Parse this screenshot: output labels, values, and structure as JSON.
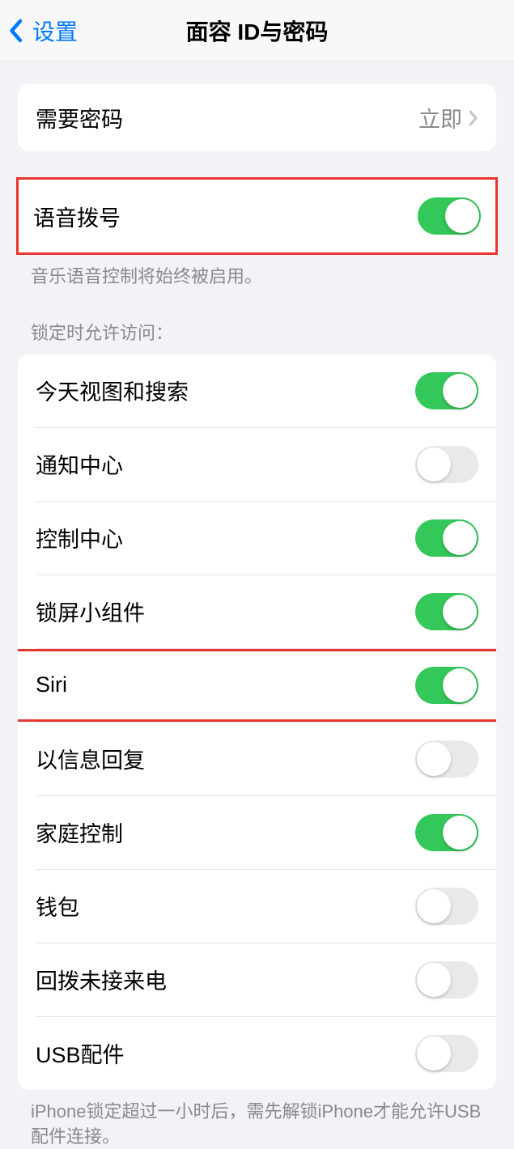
{
  "nav": {
    "back_label": "设置",
    "title": "面容 ID与密码"
  },
  "passcode_section": {
    "require_passcode_label": "需要密码",
    "require_passcode_value": "立即"
  },
  "voice_dial": {
    "label": "语音拨号",
    "footer": "音乐语音控制将始终被启用。",
    "enabled": true
  },
  "lock_access": {
    "header": "锁定时允许访问：",
    "items": [
      {
        "label": "今天视图和搜索",
        "enabled": true
      },
      {
        "label": "通知中心",
        "enabled": false
      },
      {
        "label": "控制中心",
        "enabled": true
      },
      {
        "label": "锁屏小组件",
        "enabled": true
      },
      {
        "label": "Siri",
        "enabled": true,
        "highlighted": true
      },
      {
        "label": "以信息回复",
        "enabled": false
      },
      {
        "label": "家庭控制",
        "enabled": true
      },
      {
        "label": "钱包",
        "enabled": false
      },
      {
        "label": "回拨未接来电",
        "enabled": false
      },
      {
        "label": "USB配件",
        "enabled": false
      }
    ],
    "footer": "iPhone锁定超过一小时后，需先解锁iPhone才能允许USB配件连接。"
  }
}
